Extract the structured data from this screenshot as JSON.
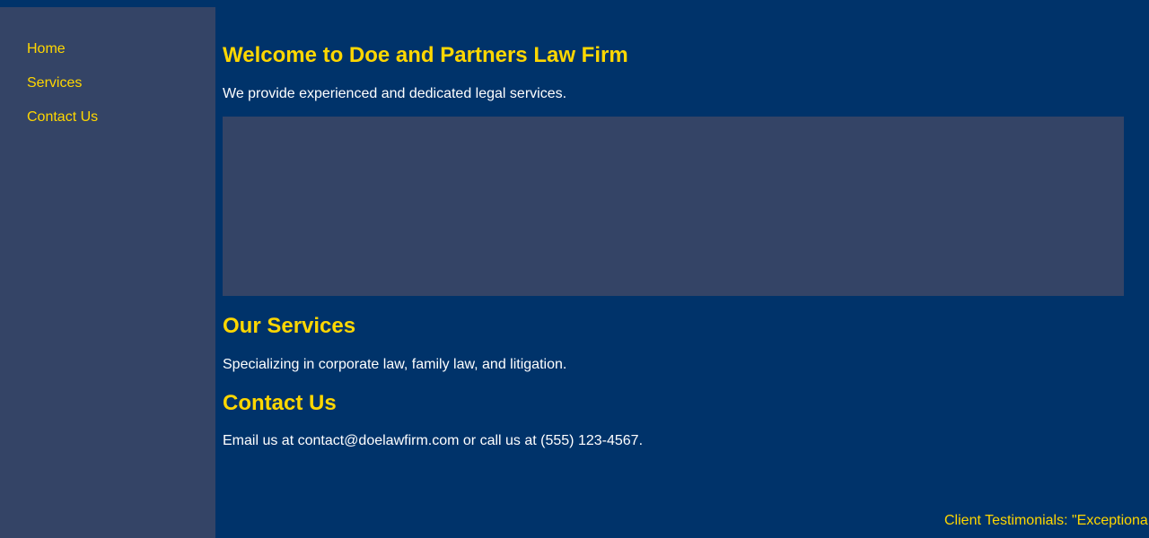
{
  "sidebar": {
    "items": [
      {
        "label": "Home"
      },
      {
        "label": "Services"
      },
      {
        "label": "Contact Us"
      }
    ]
  },
  "hero": {
    "title": "Welcome to Doe and Partners Law Firm",
    "subtitle": "We provide experienced and dedicated legal services."
  },
  "services": {
    "heading": "Our Services",
    "text": "Specializing in corporate law, family law, and litigation."
  },
  "contact": {
    "heading": "Contact Us",
    "text": "Email us at contact@doelawfirm.com or call us at (555) 123-4567."
  },
  "ticker": {
    "text": "Client Testimonials: \"Exceptiona"
  },
  "colors": {
    "page_background": "#00336a",
    "panel_background": "#344466",
    "accent": "#ffd700",
    "body_text": "#ffffff"
  }
}
